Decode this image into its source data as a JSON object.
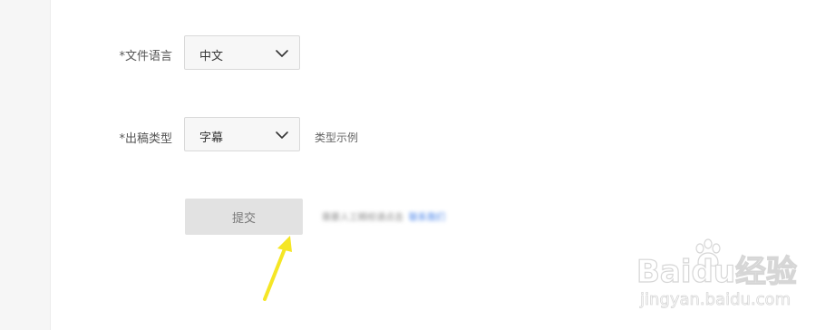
{
  "form": {
    "language": {
      "label": "*文件语言",
      "value": "中文",
      "icon": "chevron-down-icon"
    },
    "output_type": {
      "label": "*出稿类型",
      "value": "字幕",
      "icon": "chevron-down-icon",
      "hint_link": "类型示例"
    },
    "submit": {
      "label": "提交",
      "note": "需要人工精校请点击",
      "note_link": "联系我们"
    }
  },
  "watermark": {
    "brand": "Baidu经验",
    "url": "jingyan.baidu.com"
  },
  "colors": {
    "arrow": "#f5e625",
    "link": "#3f7de8",
    "button_bg": "#e2e2e2"
  }
}
